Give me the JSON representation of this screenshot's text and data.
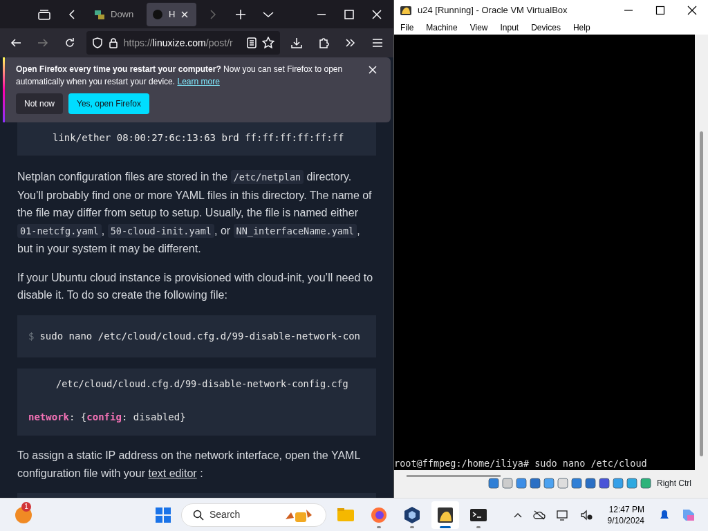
{
  "browser": {
    "tabs": [
      {
        "label": "Down",
        "selected": false
      },
      {
        "label": "H",
        "selected": true
      }
    ],
    "url": [
      {
        "t": "https://",
        "dim": true
      },
      {
        "t": "linuxize.com",
        "dim": false
      },
      {
        "t": "/post/r",
        "dim": true
      }
    ],
    "notification": {
      "text": "**Open Firefox every time you restart your computer?** Now you can set Firefox to open automatically when you restart your device.",
      "link": "Learn more",
      "buttons": [
        {
          "label": "Not now",
          "kind": "secondary"
        },
        {
          "label": "Yes, open Firefox",
          "kind": "primary"
        }
      ]
    },
    "article": [
      {
        "kind": "code",
        "lines": [
          [
            {
              "t": "link/ether 08:00:27:6c:13:63 brd ff:ff:ff:ff:ff:ff",
              "key": false
            }
          ]
        ]
      },
      {
        "kind": "paragraph",
        "segments": [
          {
            "t": "Netplan configuration files are stored in the ",
            "code": false
          },
          {
            "t": "/etc/netplan",
            "code": true
          },
          {
            "t": " directory. You’ll probably find one or more YAML files in this directory. The name of the file may differ from setup to setup. Usually, the file is named either ",
            "code": false
          },
          {
            "t": "01-netcfg.yaml",
            "code": true
          },
          {
            "t": ", ",
            "code": false
          },
          {
            "t": "50-cloud-init.yaml",
            "code": true
          },
          {
            "t": ", or ",
            "code": false
          },
          {
            "t": "NN_interfaceName.yaml",
            "code": true
          },
          {
            "t": ", but in your system it may be different.",
            "code": false
          }
        ]
      },
      {
        "kind": "paragraph",
        "segments": [
          {
            "t": "If your Ubuntu cloud instance is provisioned with cloud-init, you’ll need to disable it. To do so create the following file:",
            "code": false
          }
        ]
      },
      {
        "kind": "command",
        "prompt": "$",
        "text": "sudo nano /etc/cloud/cloud.cfg.d/99-disable-network-con"
      },
      {
        "kind": "file",
        "filename": "/etc/cloud/cloud.cfg.d/99-disable-network-config.cfg",
        "lines": [
          [
            {
              "t": "network",
              "key": true
            },
            {
              "t": ": {",
              "key": false
            },
            {
              "t": "config",
              "key": true
            },
            {
              "t": ": disabled}",
              "key": false
            }
          ]
        ]
      },
      {
        "kind": "paragraph",
        "segments": [
          {
            "t": "To assign a static IP address on the network interface, open the YAML configuration file with your ",
            "code": false
          },
          {
            "t": "text editor",
            "code": false,
            "link": true
          },
          {
            "t": " :",
            "code": false
          }
        ]
      },
      {
        "kind": "code"
      }
    ]
  },
  "vbox": {
    "title": "u24 [Running] - Oracle VM VirtualBox",
    "menu": [
      "File",
      "Machine",
      "View",
      "Input",
      "Devices",
      "Help"
    ],
    "terminal_line": "root@ffmpeg:/home/iliya# sudo nano /etc/cloud",
    "host_key": "Right Ctrl"
  },
  "taskbar": {
    "badge": "1",
    "search": "Search",
    "apps": [
      {
        "kind": "explorer",
        "running": false,
        "selected": false
      },
      {
        "kind": "firefox",
        "running": true,
        "selected": false
      },
      {
        "kind": "virtualbox",
        "running": true,
        "selected": false
      },
      {
        "kind": "vm",
        "running": true,
        "selected": true
      },
      {
        "kind": "terminal",
        "running": true,
        "selected": false
      }
    ],
    "time": "12:47 PM",
    "date": "9/10/2024"
  }
}
